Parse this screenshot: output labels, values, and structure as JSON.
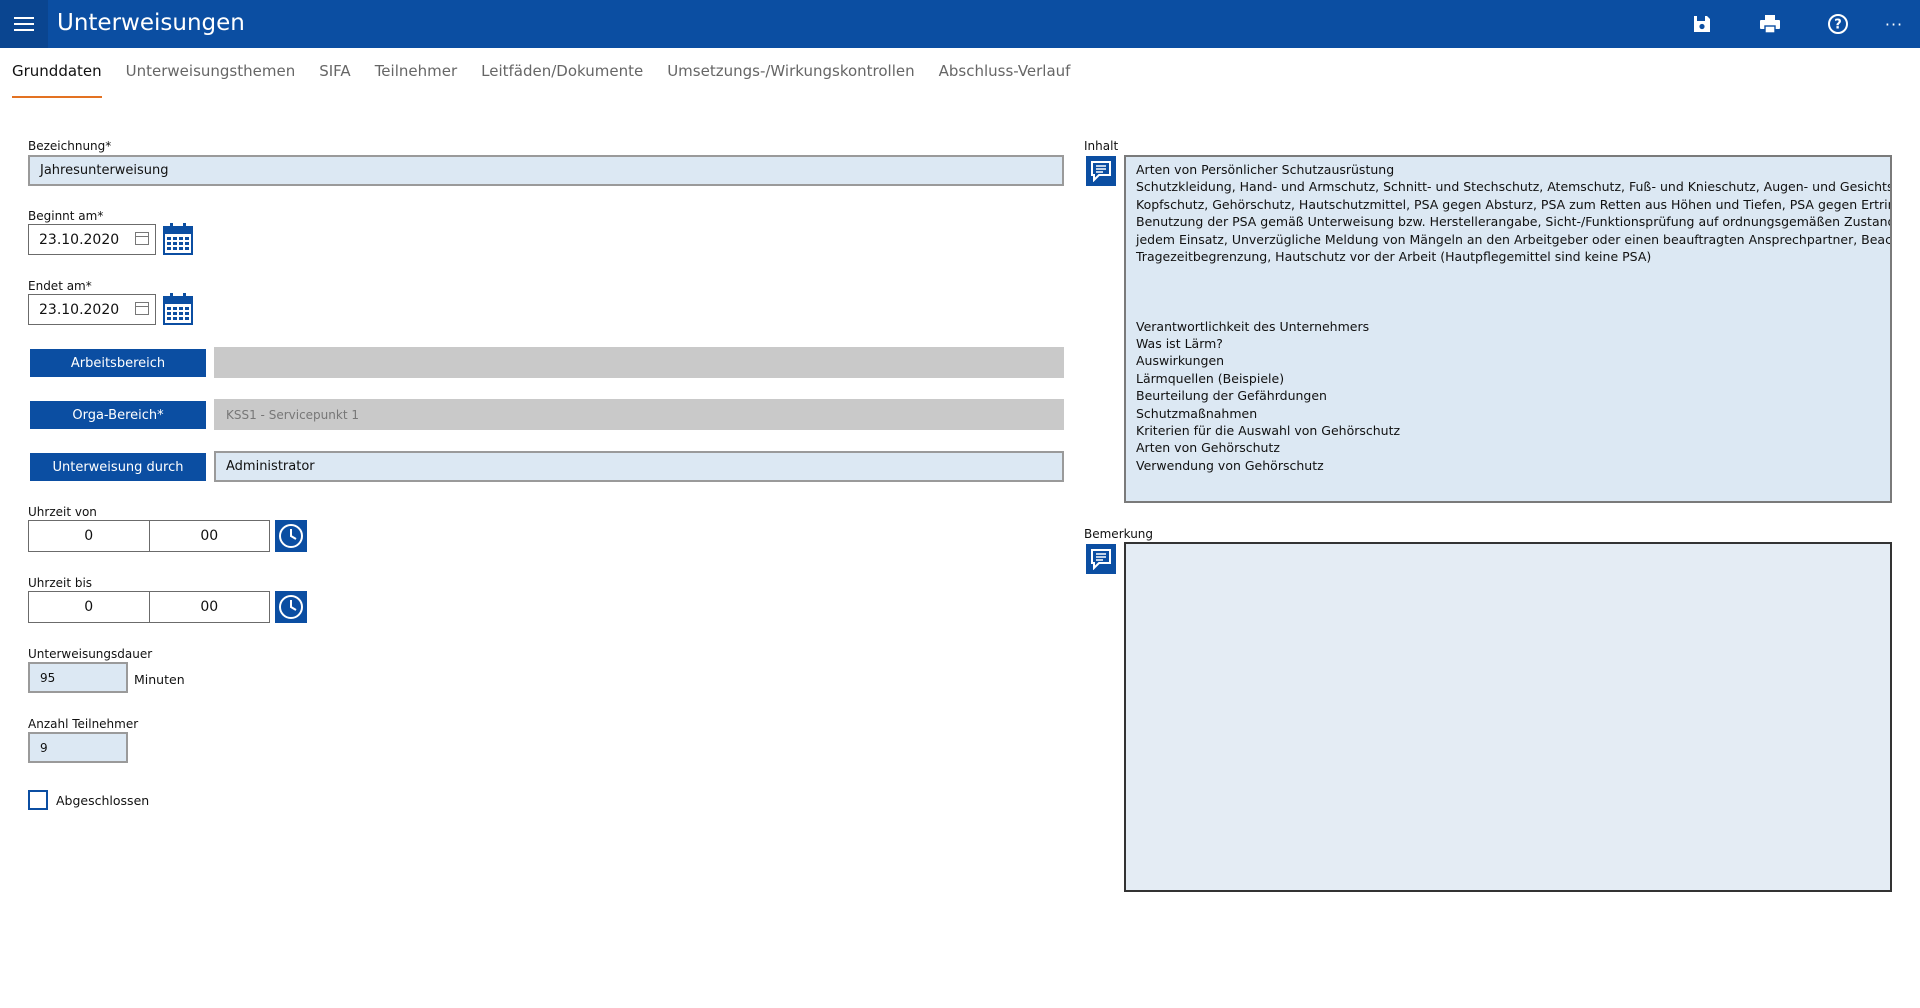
{
  "app": {
    "title": "Unterweisungen"
  },
  "toolbar": {
    "save_icon": "save-icon",
    "print_icon": "print-icon",
    "help_icon": "help-icon",
    "more_label": "···"
  },
  "tabs": [
    {
      "label": "Grunddaten",
      "active": true
    },
    {
      "label": "Unterweisungsthemen",
      "active": false
    },
    {
      "label": "SIFA",
      "active": false
    },
    {
      "label": "Teilnehmer",
      "active": false
    },
    {
      "label": "Leitfäden/Dokumente",
      "active": false
    },
    {
      "label": "Umsetzungs-/Wirkungskontrollen",
      "active": false
    },
    {
      "label": "Abschluss-Verlauf",
      "active": false
    }
  ],
  "form": {
    "bezeichnung": {
      "label": "Bezeichnung*",
      "value": "Jahresunterweisung"
    },
    "beginnt": {
      "label": "Beginnt am*",
      "value": "23.10.2020"
    },
    "endet": {
      "label": "Endet am*",
      "value": "23.10.2020"
    },
    "arbeitsbereich": {
      "button": "Arbeitsbereich",
      "value": ""
    },
    "orga": {
      "button": "Orga-Bereich*",
      "value": "KSS1 - Servicepunkt 1"
    },
    "durch": {
      "button": "Unterweisung durch",
      "value": "Administrator"
    },
    "uhrzeit_von": {
      "label": "Uhrzeit von",
      "hour": "0",
      "minute": "00"
    },
    "uhrzeit_bis": {
      "label": "Uhrzeit bis",
      "hour": "0",
      "minute": "00"
    },
    "dauer": {
      "label": "Unterweisungsdauer",
      "value": "95",
      "unit": "Minuten"
    },
    "anzahl": {
      "label": "Anzahl Teilnehmer",
      "value": "9"
    },
    "abgeschlossen": {
      "label": "Abgeschlossen",
      "checked": false
    }
  },
  "inhalt": {
    "label": "Inhalt",
    "lines": [
      "Arten von Persönlicher Schutzausrüstung",
      "Schutzkleidung, Hand- und Armschutz, Schnitt- und Stechschutz, Atemschutz, Fuß- und Knieschutz, Augen- und Gesichtsschutz,",
      "Kopfschutz, Gehörschutz, Hautschutzmittel, PSA gegen Absturz, PSA zum Retten aus Höhen und Tiefen, PSA gegen Ertrinken,",
      "Benutzung der PSA gemäß Unterweisung bzw. Herstellerangabe, Sicht-/Funktionsprüfung auf ordnungsgemäßen Zustand vor",
      "jedem Einsatz, Unverzügliche Meldung von Mängeln an den Arbeitgeber oder einen beauftragten Ansprechpartner, Beachtung der",
      "Tragezeitbegrenzung, Hautschutz vor der Arbeit (Hautpflegemittel sind keine PSA)",
      "",
      "",
      "",
      "Verantwortlichkeit des Unternehmers",
      "Was ist Lärm?",
      "Auswirkungen",
      "Lärmquellen (Beispiele)",
      "Beurteilung der Gefährdungen",
      "Schutzmaßnahmen",
      "Kriterien für die Auswahl von Gehörschutz",
      "Arten von Gehörschutz",
      "Verwendung von Gehörschutz"
    ]
  },
  "bemerkung": {
    "label": "Bemerkung",
    "value": ""
  },
  "colors": {
    "accent": "#0b4ea2",
    "tab_underline": "#e37222",
    "field_bg": "#dce8f3"
  }
}
